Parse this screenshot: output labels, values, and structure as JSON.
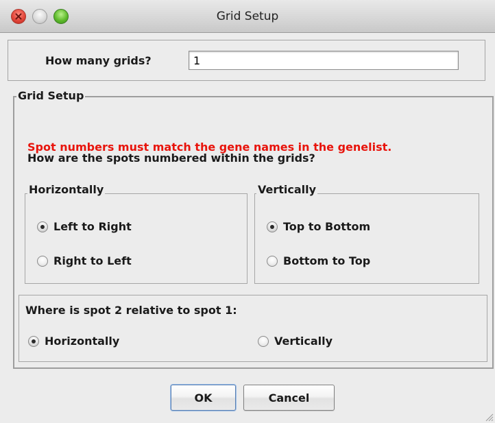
{
  "window": {
    "title": "Grid Setup"
  },
  "grids": {
    "label": "How many grids?",
    "value": "1"
  },
  "group": {
    "label": "Grid Setup",
    "warning": "Spot numbers must match the gene names in the genelist.",
    "question": "How are the spots numbered within the grids?",
    "warning_color": "#e8140c"
  },
  "horizontal": {
    "label": "Horizontally",
    "options": [
      "Left to Right",
      "Right to Left"
    ],
    "selected": "Left to Right"
  },
  "vertical": {
    "label": "Vertically",
    "options": [
      "Top to Bottom",
      "Bottom to Top"
    ],
    "selected": "Top to Bottom"
  },
  "relative": {
    "label": "Where is spot 2 relative to spot 1:",
    "options": [
      "Horizontally",
      "Vertically"
    ],
    "selected": "Horizontally"
  },
  "buttons": {
    "ok": "OK",
    "cancel": "Cancel"
  },
  "icons": {
    "close": "close-icon",
    "minimize": "minimize-icon",
    "zoom": "zoom-icon",
    "resize": "resize-grip-icon"
  }
}
